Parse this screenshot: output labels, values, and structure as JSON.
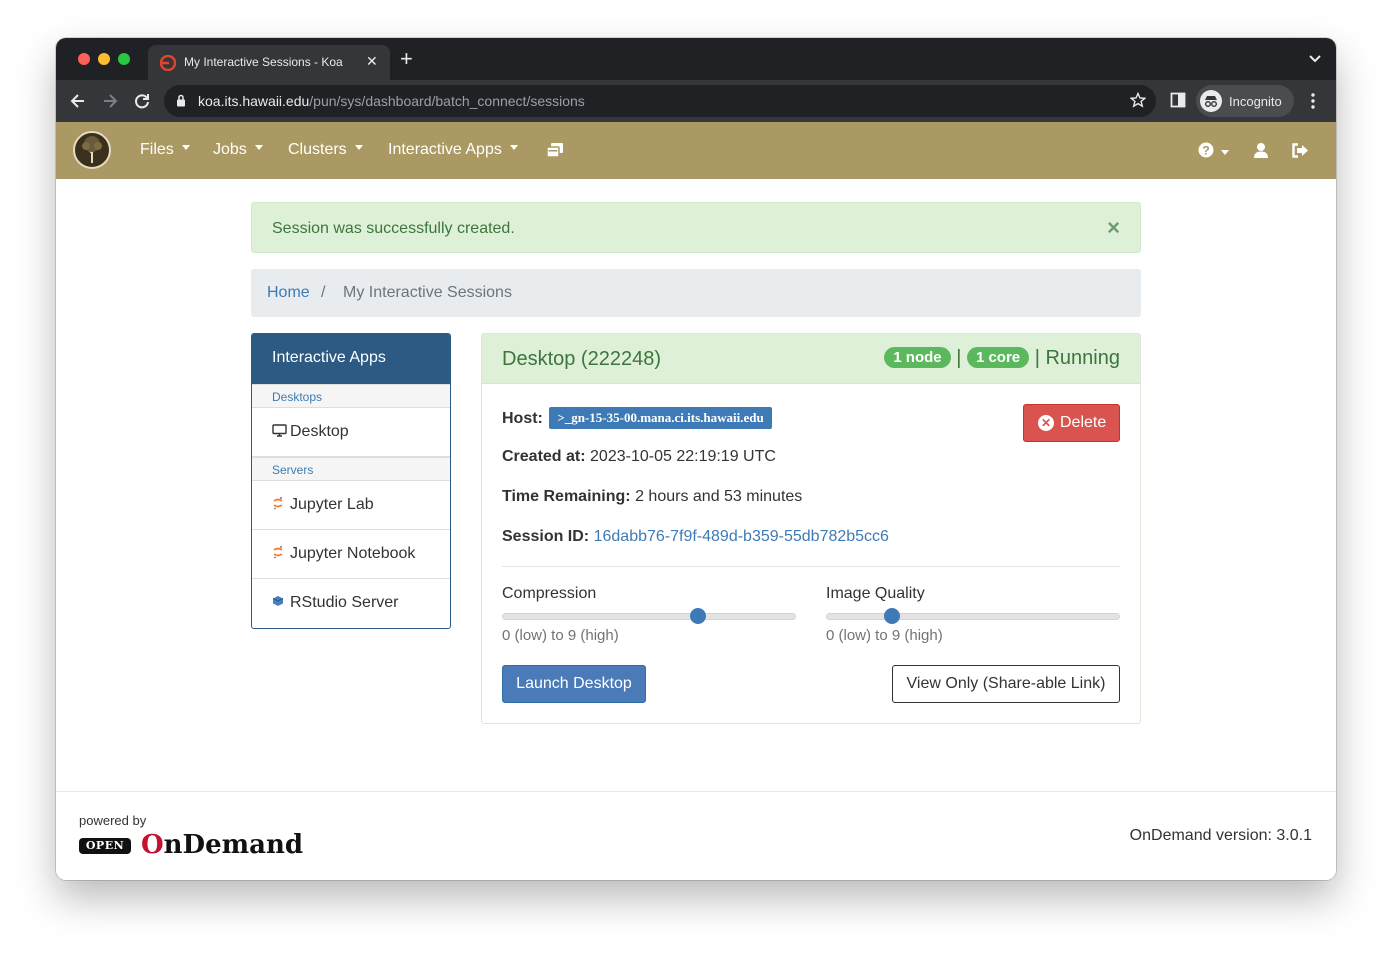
{
  "browser": {
    "tab_title": "My Interactive Sessions - Koa",
    "url_host": "koa.its.hawaii.edu",
    "url_path": "/pun/sys/dashboard/batch_connect/sessions",
    "profile_label": "Incognito"
  },
  "navbar": {
    "brand_color": "#ab9963",
    "items": [
      {
        "label": "Files"
      },
      {
        "label": "Jobs"
      },
      {
        "label": "Clusters"
      },
      {
        "label": "Interactive Apps"
      }
    ]
  },
  "alert": {
    "message": "Session was successfully created.",
    "close_glyph": "×"
  },
  "breadcrumb": {
    "home": "Home",
    "separator": "/",
    "current": "My Interactive Sessions"
  },
  "sidebar": {
    "title": "Interactive Apps",
    "groups": [
      {
        "label": "Desktops",
        "items": [
          {
            "label": "Desktop",
            "icon": "monitor-icon"
          }
        ]
      },
      {
        "label": "Servers",
        "items": [
          {
            "label": "Jupyter Lab",
            "icon": "jupyter-icon"
          },
          {
            "label": "Jupyter Notebook",
            "icon": "jupyter-icon"
          },
          {
            "label": "RStudio Server",
            "icon": "rstudio-icon"
          }
        ]
      }
    ]
  },
  "session": {
    "title": "Desktop (222248)",
    "nodes_badge": "1 node",
    "cores_badge": "1 core",
    "pipe": "|",
    "state": "Running",
    "host_label": "Host:",
    "host_value": ">_gn-15-35-00.mana.ci.its.hawaii.edu",
    "created_label": "Created at:",
    "created_value": "2023-10-05 22:19:19 UTC",
    "remaining_label": "Time Remaining:",
    "remaining_value": "2 hours and 53 minutes",
    "id_label": "Session ID:",
    "id_value": "16dabb76-7f9f-489d-b359-55db782b5cc6",
    "delete_label": "Delete",
    "compression": {
      "label": "Compression",
      "help": "0 (low) to 9 (high)",
      "value": 6,
      "min": 0,
      "max": 9
    },
    "quality": {
      "label": "Image Quality",
      "help": "0 (low) to 9 (high)",
      "value": 2,
      "min": 0,
      "max": 9
    },
    "launch_label": "Launch Desktop",
    "share_label": "View Only (Share-able Link)"
  },
  "footer": {
    "powered_by": "powered by",
    "logo_open": "OPEN",
    "logo_word": "OnDemand",
    "version": "OnDemand version: 3.0.1"
  }
}
